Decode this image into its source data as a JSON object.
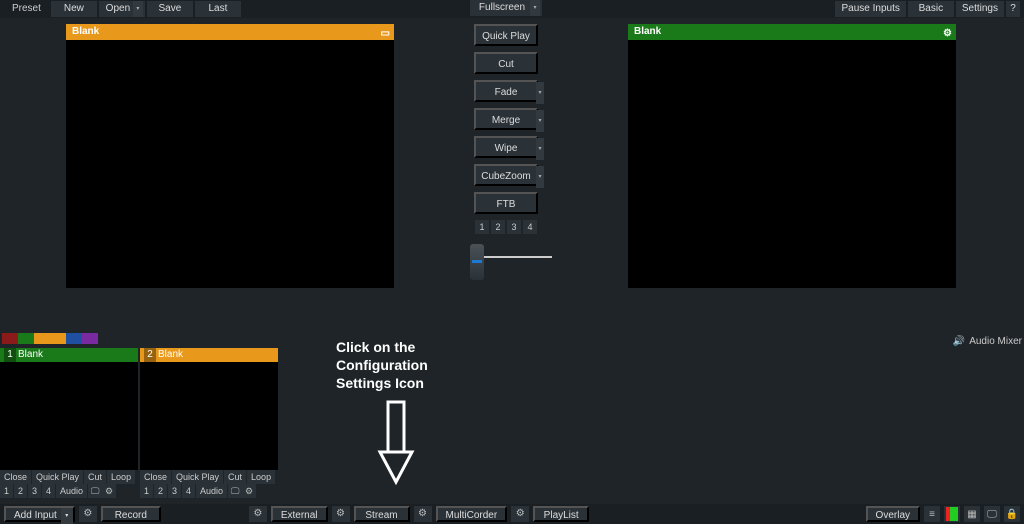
{
  "topbar": {
    "preset": "Preset",
    "new": "New",
    "open": "Open",
    "save": "Save",
    "last": "Last",
    "fullscreen": "Fullscreen",
    "pause_inputs": "Pause Inputs",
    "basic": "Basic",
    "settings": "Settings",
    "help": "?"
  },
  "panels": {
    "preview": {
      "title": "Blank"
    },
    "output": {
      "title": "Blank"
    }
  },
  "transitions": {
    "quick_play": "Quick Play",
    "cut": "Cut",
    "fade": "Fade",
    "merge": "Merge",
    "wipe": "Wipe",
    "cubezoom": "CubeZoom",
    "ftb": "FTB",
    "overlays": [
      "1",
      "2",
      "3",
      "4"
    ]
  },
  "color_chips": [
    "#8b1a1a",
    "#1a7a1a",
    "#e8991b",
    "#e8991b",
    "#1e4fa0",
    "#7a2aa0"
  ],
  "inputs": [
    {
      "num": "1",
      "title": "Blank",
      "color": "green",
      "row1": [
        "Close",
        "Quick Play",
        "Cut",
        "Loop"
      ],
      "row2": [
        "1",
        "2",
        "3",
        "4",
        "Audio"
      ]
    },
    {
      "num": "2",
      "title": "Blank",
      "color": "orange",
      "row1": [
        "Close",
        "Quick Play",
        "Cut",
        "Loop"
      ],
      "row2": [
        "1",
        "2",
        "3",
        "4",
        "Audio"
      ]
    }
  ],
  "annotation": {
    "line1": "Click on the",
    "line2": "Configuration",
    "line3": "Settings Icon"
  },
  "audio_mixer": "Audio Mixer",
  "bottombar": {
    "add_input": "Add Input",
    "record": "Record",
    "external": "External",
    "stream": "Stream",
    "multicorder": "MultiCorder",
    "playlist": "PlayList",
    "overlay": "Overlay"
  }
}
